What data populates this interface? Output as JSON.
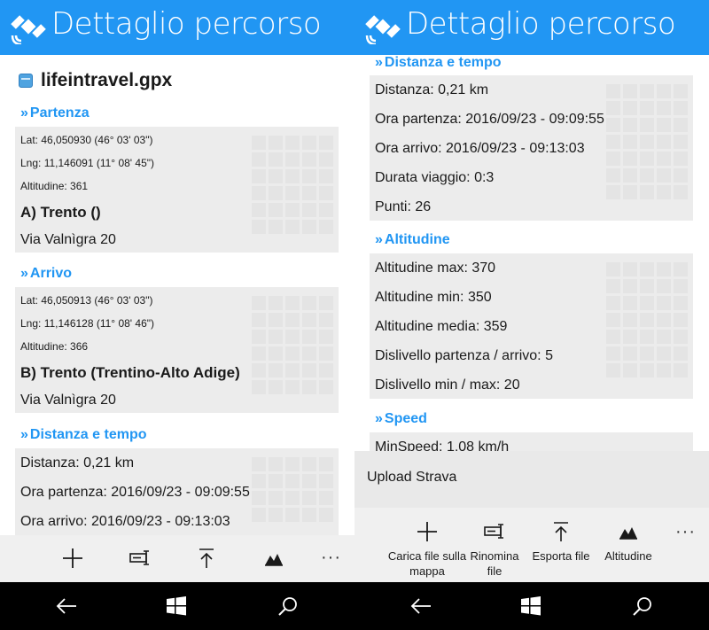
{
  "colors": {
    "accent": "#2196f3",
    "box": "#ececec",
    "bar": "#f0f0f0",
    "nav": "#000000"
  },
  "left": {
    "title": "Dettaglio percorso",
    "file_name": "lifeintravel.gpx",
    "partenza": {
      "heading": "Partenza",
      "lat": "Lat: 46,050930 (46° 03' 03\")",
      "lng": "Lng: 11,146091 (11° 08' 45\")",
      "alt": "Altitudine: 361",
      "place": "A) Trento ()",
      "street": "Via Valnìgra 20"
    },
    "arrivo": {
      "heading": "Arrivo",
      "lat": "Lat: 46,050913 (46° 03' 03\")",
      "lng": "Lng: 11,146128 (11° 08' 46\")",
      "alt": "Altitudine: 366",
      "place": "B) Trento (Trentino-Alto Adige)",
      "street": "Via Valnìgra 20"
    },
    "distanza": {
      "heading": "Distanza e tempo",
      "distance": "Distanza: 0,21 km",
      "start": "Ora partenza: 2016/09/23 - 09:09:55",
      "end": "Ora arrivo: 2016/09/23 - 09:13:03"
    },
    "more": "···"
  },
  "right": {
    "title": "Dettaglio percorso",
    "distanza": {
      "heading": "Distanza e tempo",
      "distance": "Distanza: 0,21 km",
      "start": "Ora partenza: 2016/09/23 - 09:09:55",
      "end": "Ora arrivo: 2016/09/23 - 09:13:03",
      "duration": "Durata viaggio: 0:3",
      "points": "Punti: 26"
    },
    "altitudine": {
      "heading": "Altitudine",
      "max": "Altitudine max: 370",
      "min": "Altitudine min: 350",
      "avg": "Altitudine media: 359",
      "diff": "Dislivello partenza / arrivo: 5",
      "minmax": "Dislivello min / max: 20"
    },
    "speed": {
      "heading": "Speed",
      "min": "MinSpeed: 1,08 km/h"
    },
    "menu": {
      "upload": "Upload Strava"
    },
    "commands": {
      "load": "Carica file sulla mappa",
      "rename": "Rinomina file",
      "export": "Esporta file",
      "altitude": "Altitudine",
      "more": "···"
    }
  },
  "icons": [
    "satellite-icon",
    "file-icon",
    "plus-icon",
    "rename-icon",
    "export-icon",
    "altitude-icon",
    "back-icon",
    "windows-icon",
    "search-icon"
  ]
}
